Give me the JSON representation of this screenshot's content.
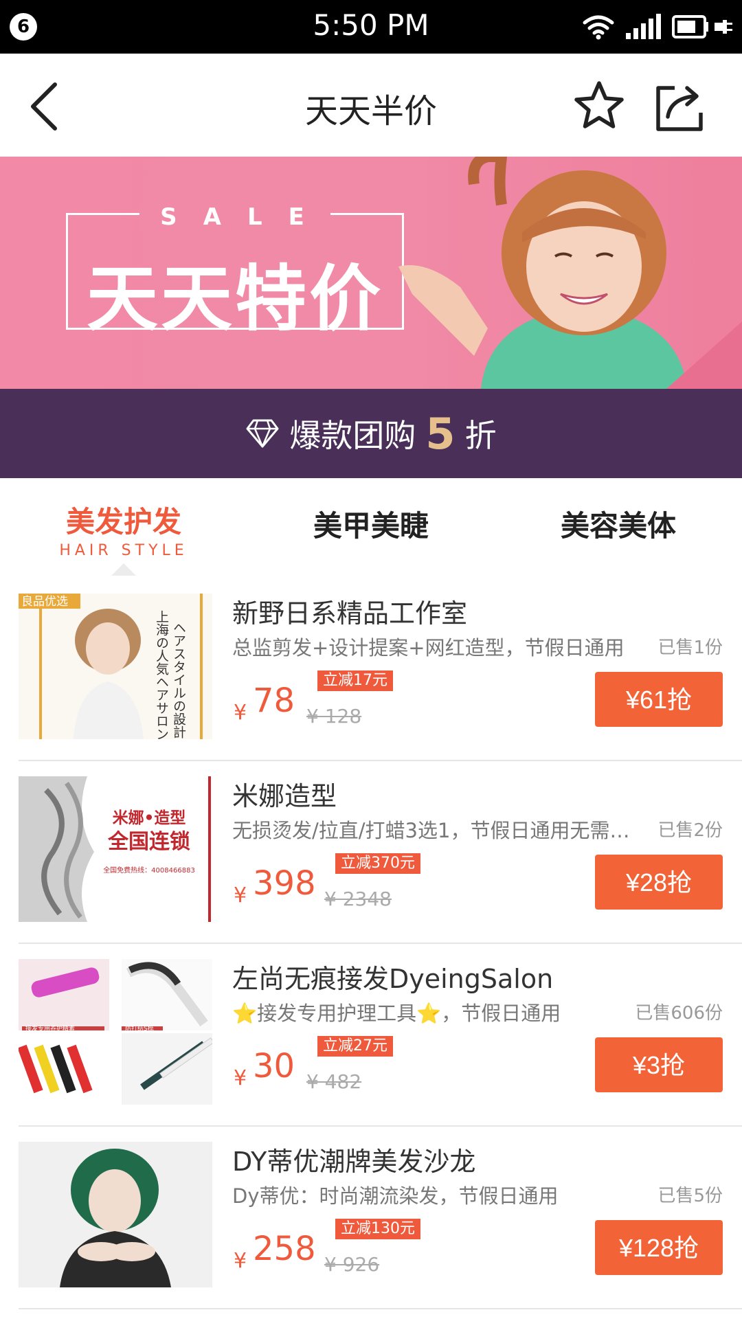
{
  "status_bar": {
    "notification_count": "6",
    "time": "5:50 PM"
  },
  "nav": {
    "title": "天天半价"
  },
  "banner": {
    "sale_label": "SALE",
    "title": "天天特价",
    "strip_prefix": "爆款团购",
    "strip_number": "5",
    "strip_suffix": "折"
  },
  "tabs": [
    {
      "label": "美发护发",
      "sub": "HAIR STYLE",
      "active": true
    },
    {
      "label": "美甲美睫",
      "active": false
    },
    {
      "label": "美容美体",
      "active": false
    }
  ],
  "deals": [
    {
      "title": "新野日系精品工作室",
      "desc": "总监剪发+设计提案+网红造型，节假日通用",
      "sold": "已售1份",
      "currency": "¥",
      "price": "78",
      "original": "¥ 128",
      "discount": "立减17元",
      "button": "¥61抢",
      "image_text": [
        "良品优选",
        "ヘアスタイルの設計",
        "上海の人気ヘアサロン"
      ]
    },
    {
      "title": "米娜造型",
      "desc": "无损烫发/拉直/打蜡3选1，节假日通用无需预约",
      "sold": "已售2份",
      "currency": "¥",
      "price": "398",
      "original": "¥ 2348",
      "discount": "立减370元",
      "button": "¥28抢",
      "image_text": [
        "米娜•造型",
        "全国连锁",
        "全国免费热线：4008466883"
      ]
    },
    {
      "title": "左尚无痕接发DyeingSalon",
      "desc": "⭐接发专用护理工具⭐，节假日通用",
      "sold": "已售606份",
      "currency": "¥",
      "price": "30",
      "original": "¥ 482",
      "discount": "立减27元",
      "button": "¥3抢",
      "image_text": [
        "接发专用养护精素",
        "防打结S梳"
      ]
    },
    {
      "title": "DY蒂优潮牌美发沙龙",
      "desc": "Dy蒂优：时尚潮流染发，节假日通用",
      "sold": "已售5份",
      "currency": "¥",
      "price": "258",
      "original": "¥ 926",
      "discount": "立减130元",
      "button": "¥128抢"
    }
  ],
  "colors": {
    "accent": "#f05a3c",
    "button": "#f26438",
    "banner_pink": "#f08aa6",
    "banner_purple": "#4a3059",
    "gold": "#e6c08c"
  }
}
